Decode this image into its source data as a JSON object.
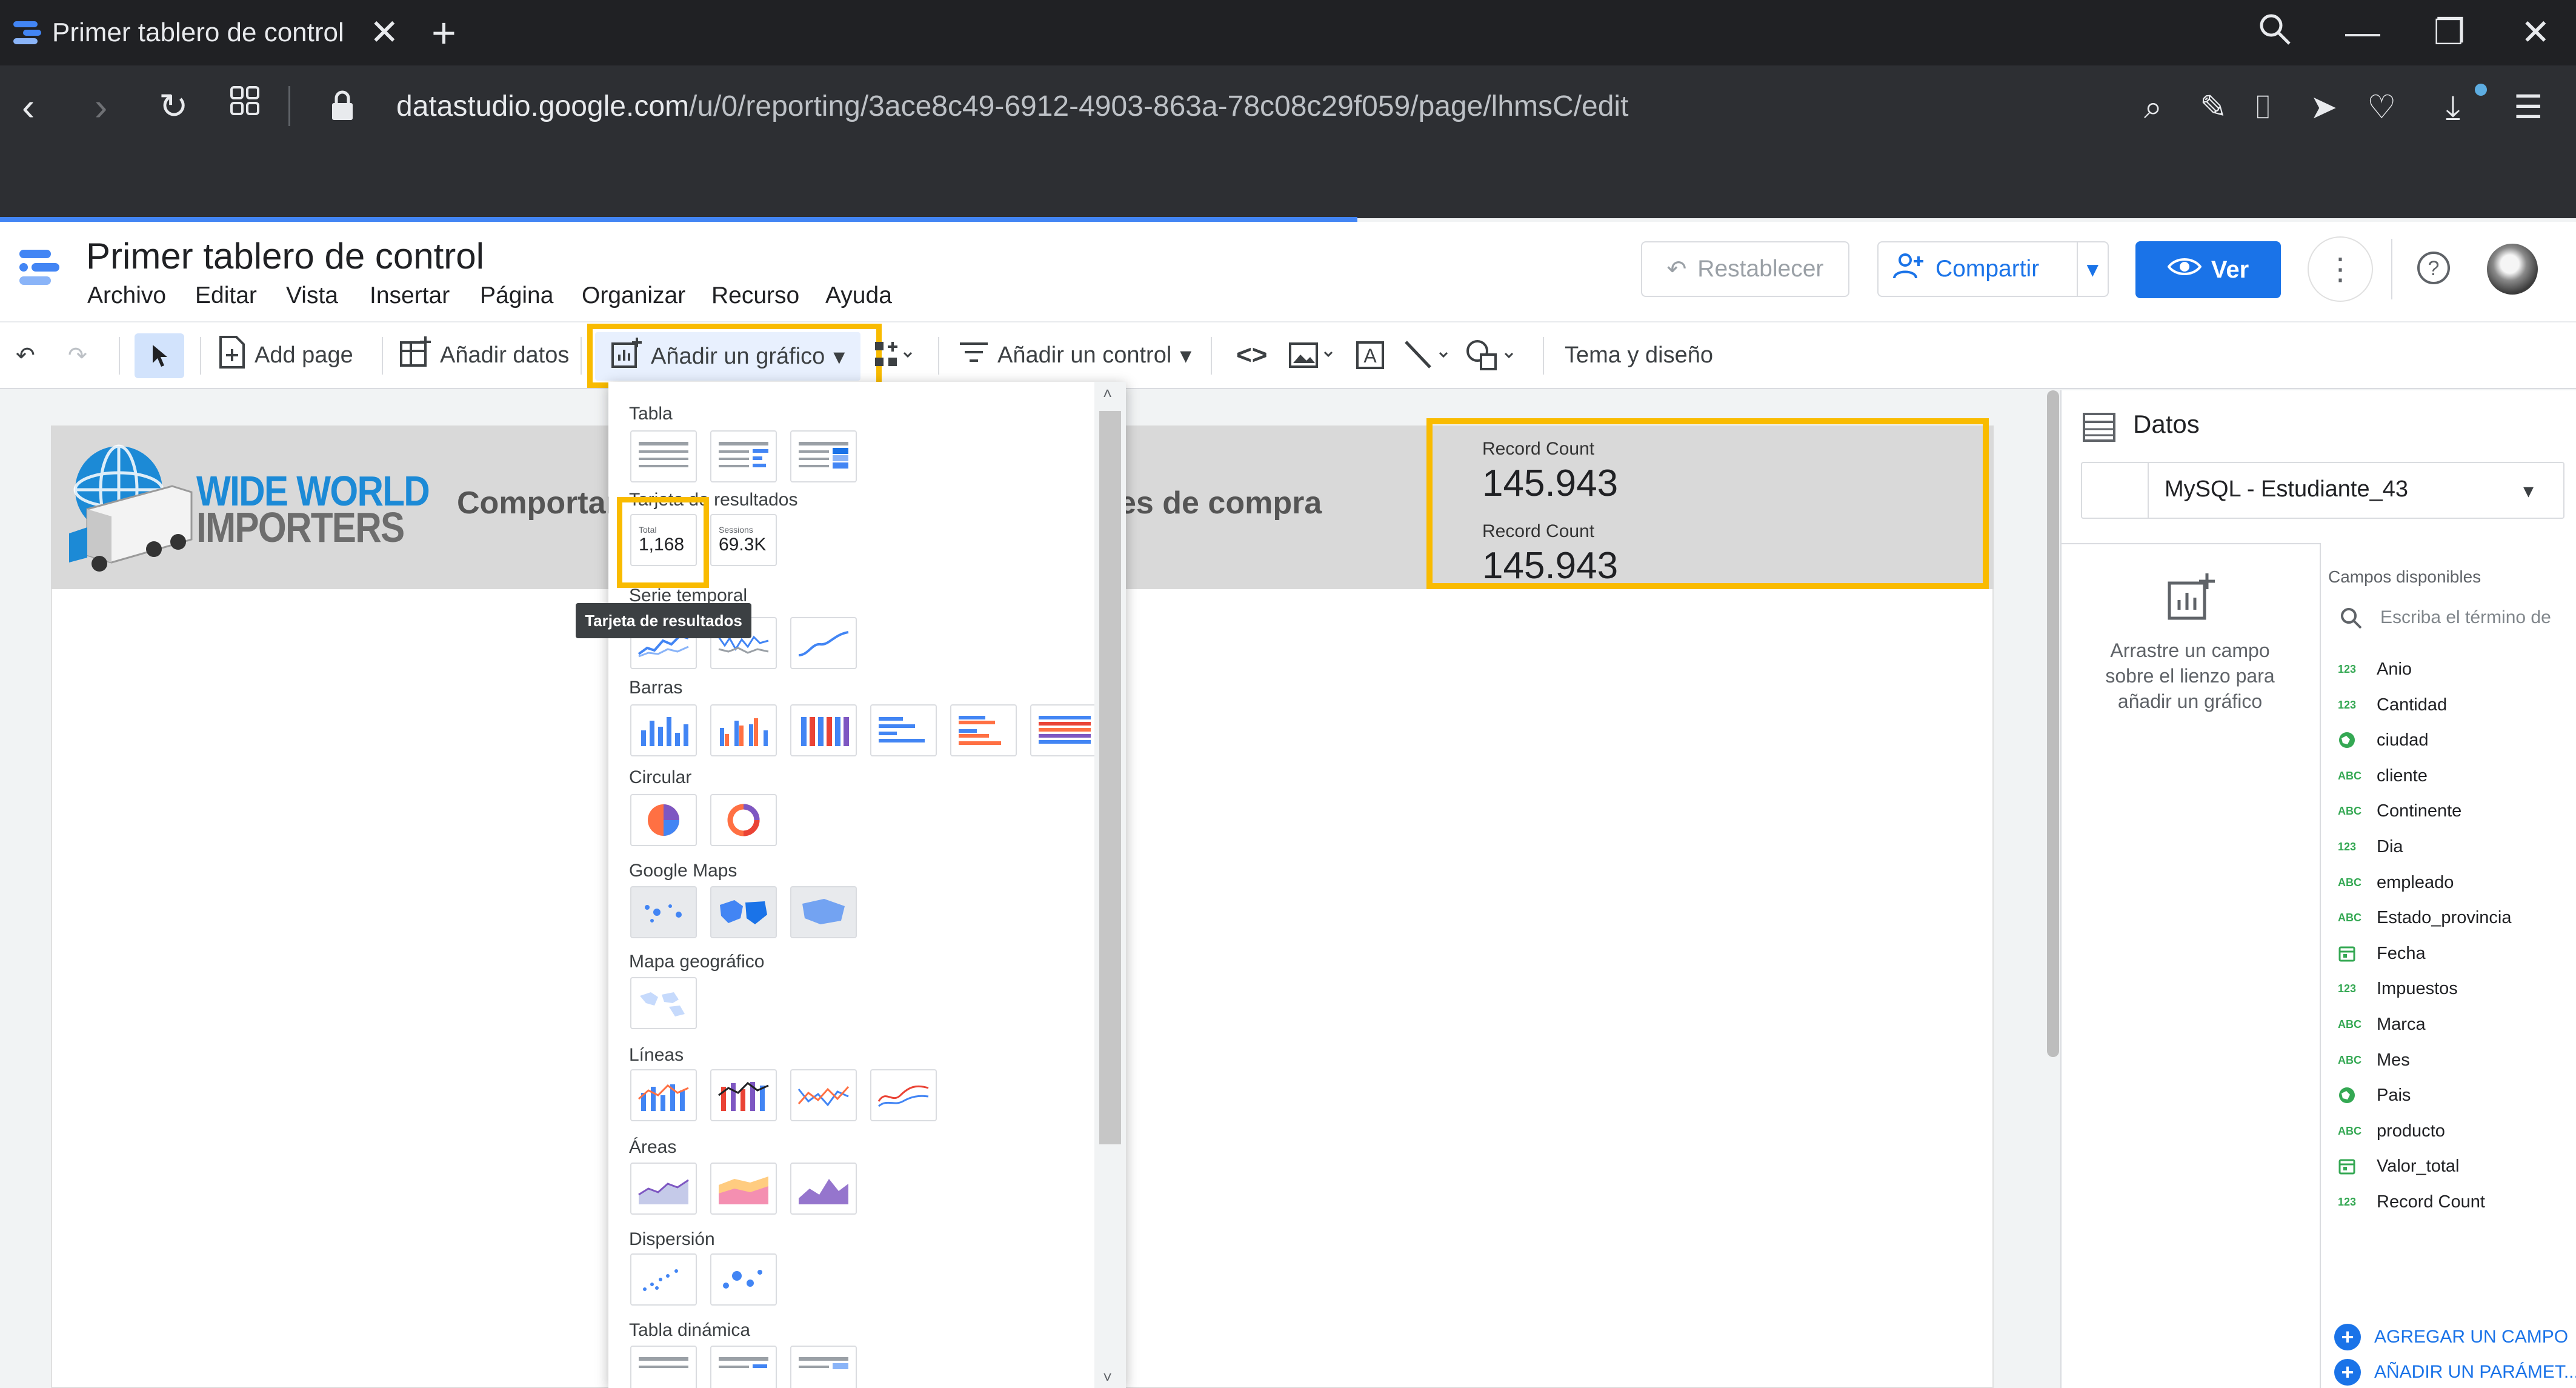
{
  "browser": {
    "tab_title": "Primer tablero de control",
    "url_host": "datastudio.google.com",
    "url_path": "/u/0/reporting/3ace8c49-6912-4903-863a-78c08c29f059/page/lhmsC/edit"
  },
  "app": {
    "doc_title": "Primer tablero de control",
    "menu": [
      "Archivo",
      "Editar",
      "Vista",
      "Insertar",
      "Página",
      "Organizar",
      "Recurso",
      "Ayuda"
    ],
    "reset_label": "Restablecer",
    "share_label": "Compartir",
    "view_label": "Ver"
  },
  "toolbar": {
    "add_page": "Add page",
    "add_data": "Añadir datos",
    "add_chart": "Añadir un gráfico",
    "add_control": "Añadir un control",
    "theme": "Tema y diseño"
  },
  "report": {
    "logo_line1": "WIDE WORLD",
    "logo_line2": "IMPORTERS",
    "title_left": "Comportar",
    "title_right": "es de compra",
    "scorecards": [
      {
        "label": "Record Count",
        "value": "145.943"
      },
      {
        "label": "Record Count",
        "value": "145.943"
      }
    ]
  },
  "chart_menu": {
    "sections": {
      "tabla": "Tabla",
      "scorecard": "Tarjeta de resultados",
      "series": "Serie temporal",
      "barras": "Barras",
      "circular": "Circular",
      "gmaps": "Google Maps",
      "geo": "Mapa geográfico",
      "lineas": "Líneas",
      "areas": "Áreas",
      "dispersion": "Dispersión",
      "pivot": "Tabla dinámica"
    },
    "scorecard_thumb1_label": "Total",
    "scorecard_thumb1_value": "1,168",
    "scorecard_thumb2_label": "Sessions",
    "scorecard_thumb2_value": "69.3K",
    "tooltip": "Tarjeta de resultados"
  },
  "data_panel": {
    "title": "Datos",
    "datasource": "MySQL - Estudiante_43",
    "drag_hint": "Arrastre un campo sobre el lienzo para añadir un gráfico",
    "available_title": "Campos disponibles",
    "search_placeholder": "Escriba el término de",
    "fields": [
      {
        "name": "Anio",
        "type": "123"
      },
      {
        "name": "Cantidad",
        "type": "123"
      },
      {
        "name": "ciudad",
        "type": "geo"
      },
      {
        "name": "cliente",
        "type": "ABC"
      },
      {
        "name": "Continente",
        "type": "ABC"
      },
      {
        "name": "Dia",
        "type": "123"
      },
      {
        "name": "empleado",
        "type": "ABC"
      },
      {
        "name": "Estado_provincia",
        "type": "ABC"
      },
      {
        "name": "Fecha",
        "type": "date"
      },
      {
        "name": "Impuestos",
        "type": "123"
      },
      {
        "name": "Marca",
        "type": "ABC"
      },
      {
        "name": "Mes",
        "type": "ABC"
      },
      {
        "name": "Pais",
        "type": "geo"
      },
      {
        "name": "producto",
        "type": "ABC"
      },
      {
        "name": "Valor_total",
        "type": "date"
      },
      {
        "name": "Record Count",
        "type": "123"
      }
    ],
    "add_field": "AGREGAR UN CAMPO",
    "add_param": "AÑADIR UN PARÁMET..."
  },
  "colors": {
    "highlight": "#f9bb00",
    "accent": "#1a73e8"
  }
}
